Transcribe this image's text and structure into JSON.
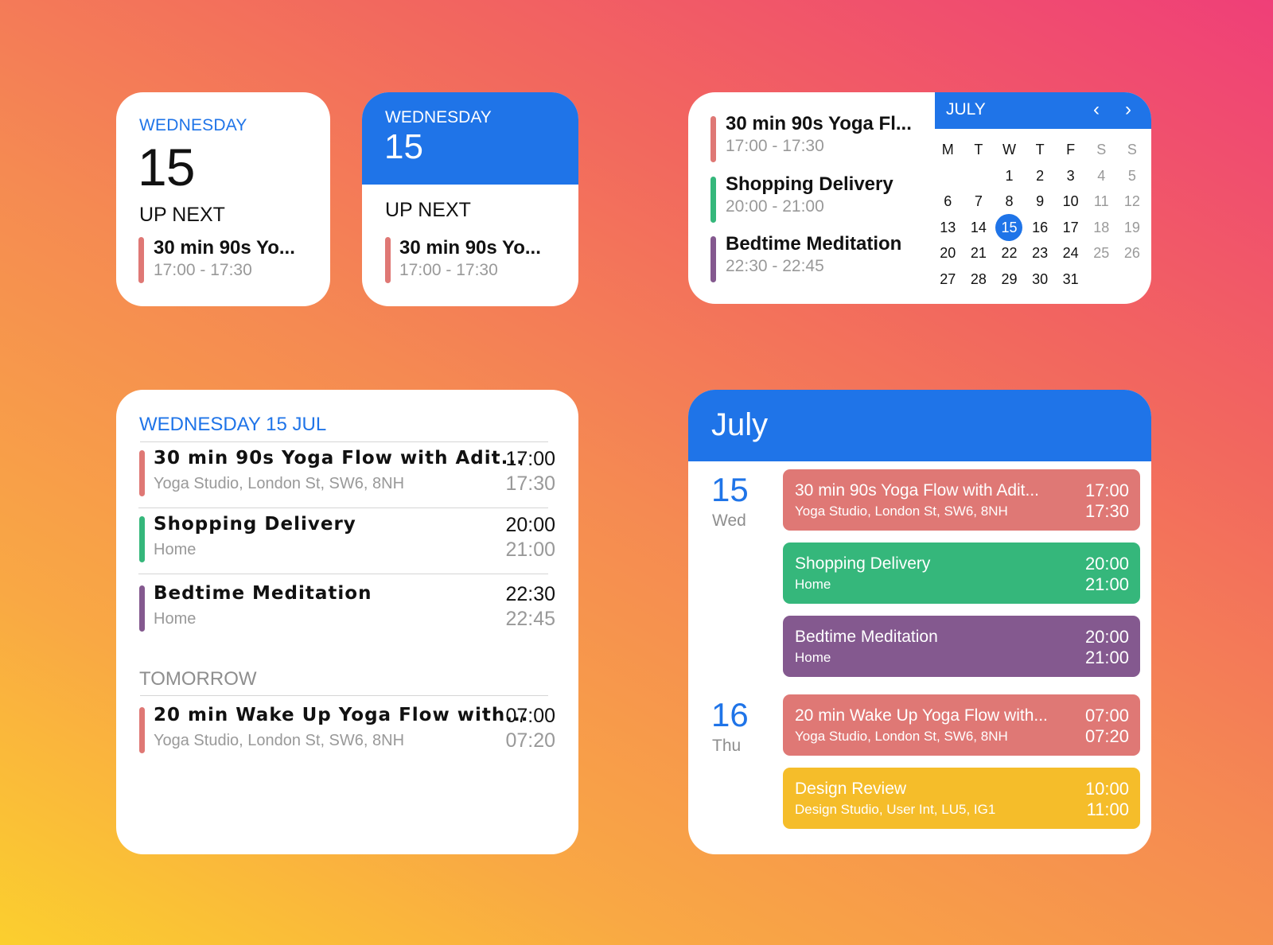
{
  "colors": {
    "accent": "#1f74e8",
    "event_red": "#df7875",
    "event_green": "#35b77b",
    "event_purple": "#84598f",
    "event_yellow": "#f5bd2a",
    "muted_text": "#999999"
  },
  "widget_small_white": {
    "weekday": "WEDNESDAY",
    "day_number": "15",
    "up_next_label": "UP NEXT",
    "event": {
      "title": "30 min 90s Yo...",
      "time": "17:00 - 17:30",
      "color": "#df7875"
    }
  },
  "widget_small_blue": {
    "weekday": "WEDNESDAY",
    "day_number": "15",
    "up_next_label": "UP NEXT",
    "event": {
      "title": "30 min 90s Yo...",
      "time": "17:00 - 17:30",
      "color": "#df7875"
    }
  },
  "widget_medium": {
    "events": [
      {
        "title": "30 min 90s Yoga Fl...",
        "time": "17:00 - 17:30",
        "color": "#df7875"
      },
      {
        "title": "Shopping Delivery",
        "time": "20:00 - 21:00",
        "color": "#35b77b"
      },
      {
        "title": "Bedtime Meditation",
        "time": "22:30 - 22:45",
        "color": "#84598f"
      }
    ],
    "month": {
      "name": "JULY",
      "prev_icon": "chevron-left-icon",
      "next_icon": "chevron-right-icon",
      "prev_glyph": "‹",
      "next_glyph": "›",
      "weekday_headers": [
        "M",
        "T",
        "W",
        "T",
        "F",
        "S",
        "S"
      ],
      "weeks": [
        [
          "",
          "",
          "1",
          "2",
          "3",
          "4",
          "5"
        ],
        [
          "6",
          "7",
          "8",
          "9",
          "10",
          "11",
          "12"
        ],
        [
          "13",
          "14",
          "15",
          "16",
          "17",
          "18",
          "19"
        ],
        [
          "20",
          "21",
          "22",
          "23",
          "24",
          "25",
          "26"
        ],
        [
          "27",
          "28",
          "29",
          "30",
          "31",
          "",
          ""
        ]
      ],
      "today": "15"
    }
  },
  "widget_large_list": {
    "date_header": "WEDNESDAY 15 JUL",
    "today_events": [
      {
        "title": "30 min 90s Yoga Flow with Adit...",
        "location": "Yoga Studio, London St, SW6, 8NH",
        "start": "17:00",
        "end": "17:30",
        "color": "#df7875"
      },
      {
        "title": "Shopping Delivery",
        "location": "Home",
        "start": "20:00",
        "end": "21:00",
        "color": "#35b77b"
      },
      {
        "title": "Bedtime Meditation",
        "location": "Home",
        "start": "22:30",
        "end": "22:45",
        "color": "#84598f"
      }
    ],
    "tomorrow_header": "TOMORROW",
    "tomorrow_events": [
      {
        "title": "20 min Wake Up Yoga Flow with...",
        "location": "Yoga Studio, London St, SW6, 8NH",
        "start": "07:00",
        "end": "07:20",
        "color": "#df7875"
      }
    ]
  },
  "widget_large_agenda": {
    "month_title": "July",
    "days": [
      {
        "day_number": "15",
        "day_name": "Wed",
        "events": [
          {
            "title": "30 min 90s Yoga Flow with Adit...",
            "location": "Yoga Studio, London St, SW6, 8NH",
            "start": "17:00",
            "end": "17:30",
            "color": "#df7875"
          },
          {
            "title": "Shopping Delivery",
            "location": "Home",
            "start": "20:00",
            "end": "21:00",
            "color": "#35b77b"
          },
          {
            "title": "Bedtime Meditation",
            "location": "Home",
            "start": "20:00",
            "end": "21:00",
            "color": "#84598f"
          }
        ]
      },
      {
        "day_number": "16",
        "day_name": "Thu",
        "events": [
          {
            "title": "20 min Wake Up Yoga Flow with...",
            "location": "Yoga Studio, London St, SW6, 8NH",
            "start": "07:00",
            "end": "07:20",
            "color": "#df7875"
          },
          {
            "title": "Design Review",
            "location": "Design Studio, User Int, LU5, IG1",
            "start": "10:00",
            "end": "11:00",
            "color": "#f5bd2a"
          }
        ]
      }
    ]
  }
}
